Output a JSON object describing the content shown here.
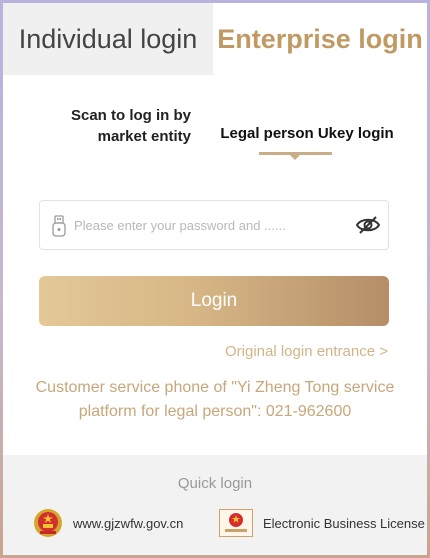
{
  "tabs": {
    "individual": "Individual login",
    "enterprise": "Enterprise login"
  },
  "sub_tabs": {
    "scan": "Scan to log in by market entity",
    "ukey": "Legal person Ukey login"
  },
  "password": {
    "placeholder": "Please enter your password and ......",
    "value": ""
  },
  "login_button": "Login",
  "original_entrance": "Original login entrance >",
  "service_phone": "Customer service phone of \"Yi Zheng Tong service platform for legal person\": 021-962600",
  "quick_login": {
    "title": "Quick login",
    "items": [
      {
        "label": "www.gjzwfw.gov.cn",
        "icon": "national-emblem-icon"
      },
      {
        "label": "Electronic Business License",
        "icon": "business-license-icon"
      }
    ]
  },
  "colors": {
    "accent": "#c19a63",
    "button_start": "#e4c898",
    "button_end": "#b58e68",
    "link": "#d1b488"
  }
}
